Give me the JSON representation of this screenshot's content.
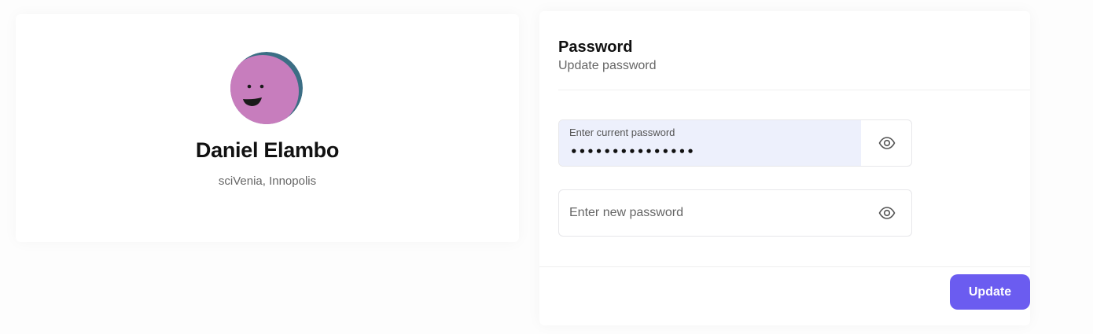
{
  "profile": {
    "name": "Daniel Elambo",
    "organization": "sciVenia, Innopolis",
    "avatar_icon": "smiling-face-avatar",
    "avatar_color": "#c77dbd",
    "avatar_ring_color": "#3c6e85"
  },
  "password_section": {
    "title": "Password",
    "subtitle": "Update password",
    "current_password": {
      "label": "Enter current password",
      "value": "•••••••••••••••",
      "visibility_icon": "eye-icon"
    },
    "new_password": {
      "placeholder": "Enter new password",
      "value": "",
      "visibility_icon": "eye-icon"
    },
    "update_button_label": "Update"
  },
  "colors": {
    "accent": "#6b5cf0",
    "focused_field_bg": "#edf0fc"
  }
}
